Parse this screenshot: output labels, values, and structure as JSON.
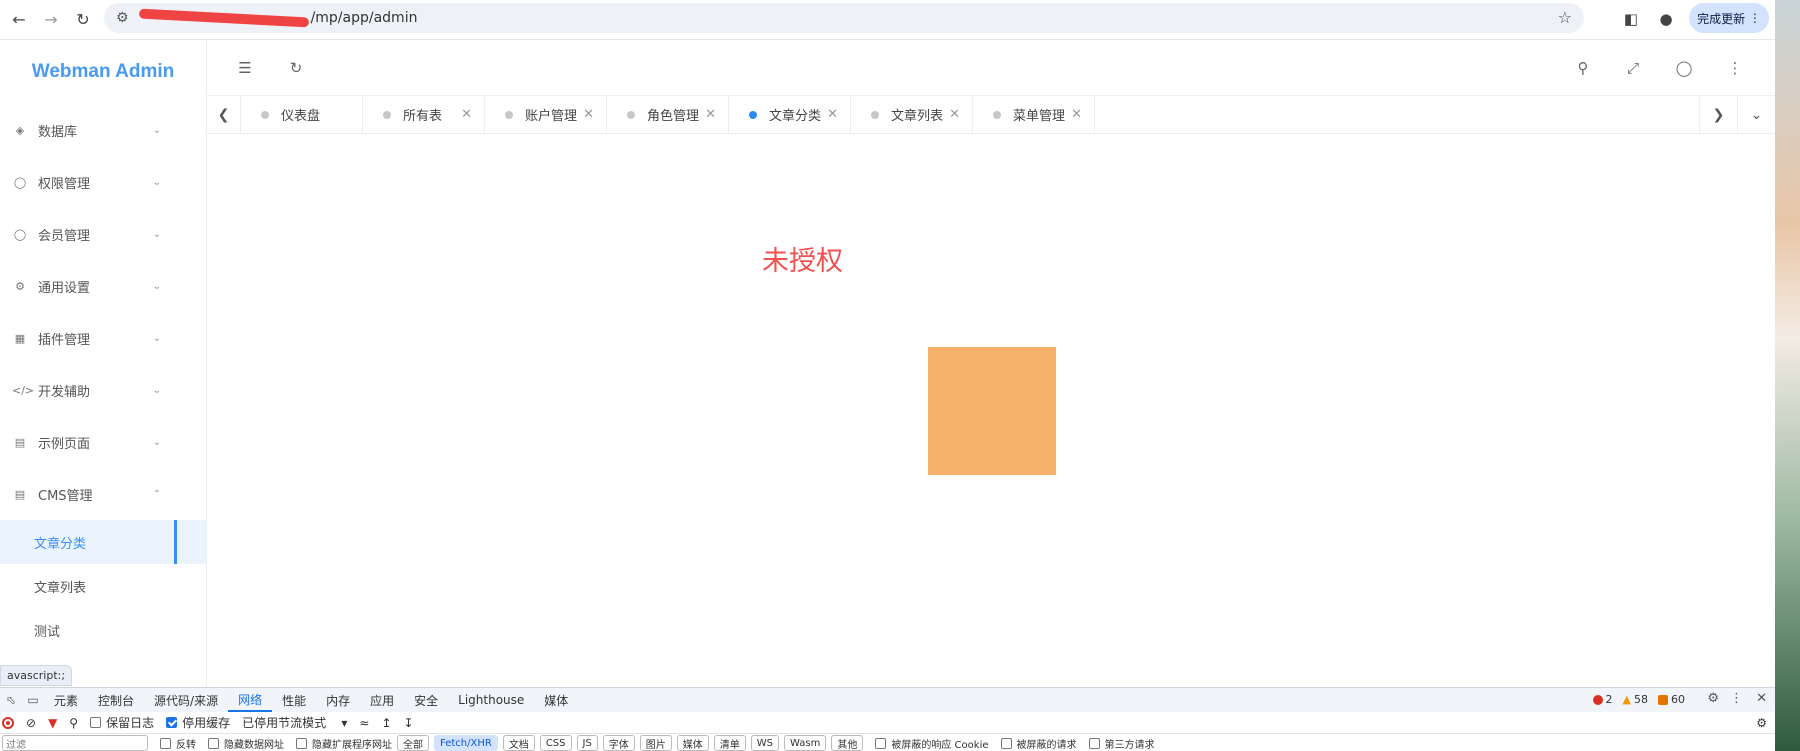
{
  "browser": {
    "url": "/mp/app/admin",
    "update_label": "完成更新"
  },
  "sidebar": {
    "logo": "Webman Admin",
    "items": [
      {
        "label": "数据库",
        "icon": "layers-icon"
      },
      {
        "label": "权限管理",
        "icon": "shield-icon"
      },
      {
        "label": "会员管理",
        "icon": "user-icon"
      },
      {
        "label": "通用设置",
        "icon": "gear-icon"
      },
      {
        "label": "插件管理",
        "icon": "apps-icon"
      },
      {
        "label": "开发辅助",
        "icon": "code-icon"
      },
      {
        "label": "示例页面",
        "icon": "chart-icon"
      },
      {
        "label": "CMS管理",
        "icon": "book-icon"
      }
    ],
    "sub_items": [
      {
        "label": "文章分类",
        "active": true
      },
      {
        "label": "文章列表",
        "active": false
      },
      {
        "label": "测试",
        "active": false
      }
    ]
  },
  "tabs": [
    {
      "label": "仪表盘",
      "active": false
    },
    {
      "label": "所有表",
      "active": false
    },
    {
      "label": "账户管理",
      "active": false
    },
    {
      "label": "角色管理",
      "active": false
    },
    {
      "label": "文章分类",
      "active": true
    },
    {
      "label": "文章列表",
      "active": false
    },
    {
      "label": "菜单管理",
      "active": false
    }
  ],
  "content": {
    "message": "未授权",
    "message_color": "#f05252",
    "square_color": "#f7b069"
  },
  "status_tip": "avascript:;",
  "devtools": {
    "tabs": [
      "元素",
      "控制台",
      "源代码/来源",
      "网络",
      "性能",
      "内存",
      "应用",
      "安全",
      "Lighthouse",
      "媒体"
    ],
    "active_tab": "网络",
    "errors": "2",
    "warnings": "58",
    "issues": "60",
    "preserve_log": "保留日志",
    "disable_cache": "停用缓存",
    "throttle": "已停用节流模式",
    "filter_placeholder": "过滤",
    "invert": "反转",
    "hide_data_urls": "隐藏数据网址",
    "hide_ext_urls": "隐藏扩展程序网址",
    "chips": [
      "全部",
      "Fetch/XHR",
      "文档",
      "CSS",
      "JS",
      "字体",
      "图片",
      "媒体",
      "清单",
      "WS",
      "Wasm",
      "其他"
    ],
    "selected_chip": "Fetch/XHR",
    "blocked_cookies": "被屏蔽的响应 Cookie",
    "blocked_requests": "被屏蔽的请求",
    "third_party": "第三方请求"
  }
}
